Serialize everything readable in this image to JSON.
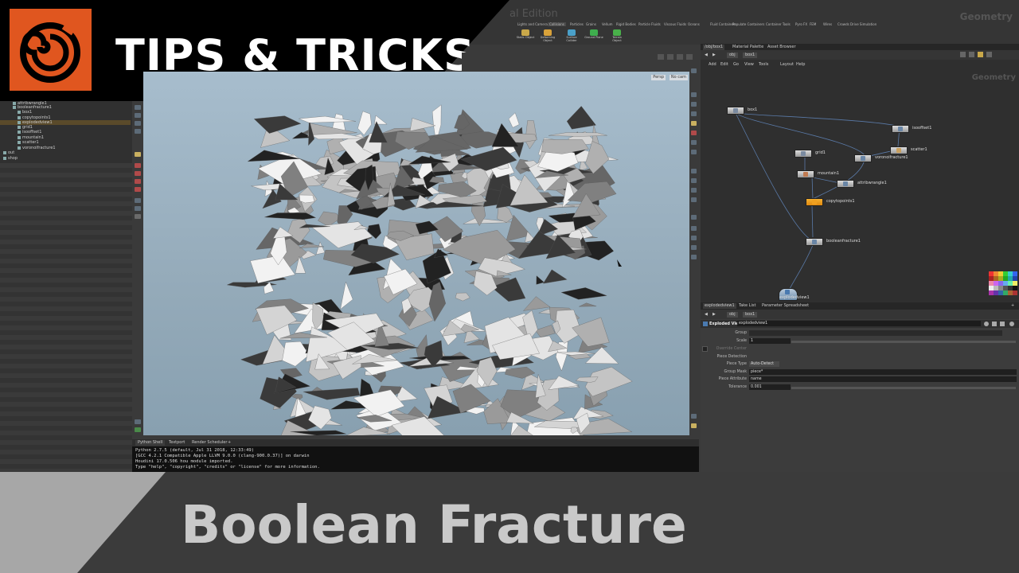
{
  "banner": {
    "title": "TIPS & TRICKS",
    "subtitle": "Boolean Fracture",
    "logo_icon": "houdini-swirl-icon",
    "brand_color": "#e0561f"
  },
  "shelf": {
    "partial_title": "al Edition",
    "desktop_label": "Geometry",
    "tabs": [
      "Lights and Cameras",
      "Collisions",
      "Particles",
      "Grains",
      "Vellum",
      "Rigid Bodies",
      "Particle Fluids",
      "Viscous Fluids",
      "Oceans",
      "Fluid Containers",
      "Populate Containers",
      "Container Tools",
      "Pyro FX",
      "FEM",
      "Wires",
      "Crowds",
      "Drive Simulation"
    ],
    "tools": [
      {
        "label": "Static Object",
        "icon": "static-object-icon",
        "color": "#c9a84a"
      },
      {
        "label": "Deforming Object",
        "icon": "deforming-object-icon",
        "color": "#d9a23a"
      },
      {
        "label": "Surface Collider",
        "icon": "surface-collider-icon",
        "color": "#4aa0c9"
      },
      {
        "label": "Ground Plane",
        "icon": "ground-plane-icon",
        "color": "#3fae4e"
      },
      {
        "label": "Terrain Object",
        "icon": "terrain-object-icon",
        "color": "#49b04a"
      }
    ]
  },
  "tree": {
    "items": [
      "attribwrangle1",
      "booleanfracture1",
      "box1",
      "copytopoints1",
      "explodedview1",
      "grid1",
      "isooffset1",
      "mountain1",
      "scatter1",
      "voronoifracture1",
      "out",
      "shop"
    ],
    "selected": "explodedview1"
  },
  "viewport": {
    "camera": "Persp",
    "cam_menu": "No cam"
  },
  "shell": {
    "tabs": [
      "Python Shell",
      "Textport",
      "Render Scheduler"
    ],
    "lines": [
      "Python 2.7.5 (default, Jul 31 2018, 12:33:49)",
      "[GCC 4.2.1 Compatible Apple LLVM 9.0.0 (clang-900.0.37)] on darwin",
      "Houdini 17.0.506 hou module imported.",
      "Type \"help\", \"copyright\", \"credits\" or \"license\" for more information."
    ]
  },
  "network": {
    "tabs": [
      "/obj/box1",
      "Material Palette",
      "Asset Browser"
    ],
    "path": [
      "obj",
      "box1"
    ],
    "menu": [
      "Add",
      "Edit",
      "Go",
      "View",
      "Tools",
      "Layout",
      "Help"
    ],
    "context_label": "Geometry",
    "nodes": [
      {
        "name": "box1",
        "color": "#7a8aa0"
      },
      {
        "name": "isooffset1",
        "color": "#6a86a6"
      },
      {
        "name": "scatter1",
        "color": "#c8a060"
      },
      {
        "name": "grid1",
        "color": "#7a8aa0"
      },
      {
        "name": "voronoifracture1",
        "color": "#6a86a6"
      },
      {
        "name": "mountain1",
        "color": "#c07a50"
      },
      {
        "name": "attribwrangle1",
        "color": "#6a86a6"
      },
      {
        "name": "copytopoints1",
        "color": "#f0a020"
      },
      {
        "name": "booleanfracture1",
        "color": "#6a86a6"
      },
      {
        "name": "explodedview1",
        "color": "#4a7ab0"
      }
    ]
  },
  "params": {
    "tabs": [
      "explodedview1",
      "Take List",
      "Parameter Spreadsheet"
    ],
    "path": [
      "obj",
      "box1"
    ],
    "node_type": "Exploded View",
    "node_name": "explodedview1",
    "rows": [
      {
        "label": "Group",
        "value": ""
      },
      {
        "label": "Scale",
        "value": "1"
      },
      {
        "label": "Override Center",
        "value": ""
      },
      {
        "label": "Piece Detection",
        "value": ""
      },
      {
        "label": "Piece Type",
        "value": "Auto-Detect"
      },
      {
        "label": "Group Mask",
        "value": "piece*"
      },
      {
        "label": "Piece Attribute",
        "value": "name"
      },
      {
        "label": "Tolerance",
        "value": "0.001"
      }
    ]
  }
}
